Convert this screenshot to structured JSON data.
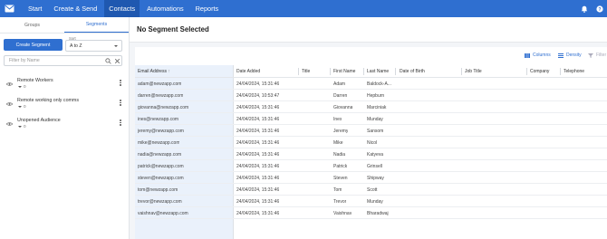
{
  "nav": {
    "items": [
      "Start",
      "Create & Send",
      "Contacts",
      "Automations",
      "Reports"
    ],
    "active_index": 2,
    "icons": [
      "bell-icon",
      "help-icon"
    ],
    "accent": "#2f6fd0"
  },
  "left": {
    "tabs": [
      "Groups",
      "Segments"
    ],
    "active_tab": 1,
    "create_label": "Create Segment",
    "sort_label": "Sort",
    "sort_value": "A to Z",
    "filter_placeholder": "Filter by Name",
    "segments": [
      {
        "name": "Remote Workers",
        "count": "0"
      },
      {
        "name": "Remote working only comms",
        "count": "0"
      },
      {
        "name": "Unopened Audience",
        "count": "0"
      }
    ]
  },
  "main": {
    "title": "No Segment Selected",
    "toolbar": {
      "columns": "Columns",
      "density": "Density",
      "filter": "Filter"
    },
    "columns": [
      "Email Address",
      "Date Added",
      "Title",
      "First Name",
      "Last Name",
      "Date of Birth",
      "Job Title",
      "Company",
      "Telephone"
    ],
    "rows": [
      [
        "adam@newzapp.com",
        "24/04/2024, 15:31:46",
        "",
        "Adam",
        "Baldock-A..."
      ],
      [
        "darren@newzapp.com",
        "24/04/2024, 10:53:47",
        "",
        "Darren",
        "Hepburn"
      ],
      [
        "giovanna@newzapp.com",
        "24/04/2024, 15:31:46",
        "",
        "Giovanna",
        "Marciniak"
      ],
      [
        "ines@newzapp.com",
        "24/04/2024, 15:31:46",
        "",
        "Ines",
        "Munday"
      ],
      [
        "jeremy@newzapp.com",
        "24/04/2024, 15:31:46",
        "",
        "Jeremy",
        "Sansom"
      ],
      [
        "mike@newzapp.com",
        "24/04/2024, 15:31:46",
        "",
        "Mike",
        "Nicol"
      ],
      [
        "nadia@newzapp.com",
        "24/04/2024, 15:31:46",
        "",
        "Nadia",
        "Katyeva"
      ],
      [
        "patrick@newzapp.com",
        "24/04/2024, 15:31:46",
        "",
        "Patrick",
        "Grinsell"
      ],
      [
        "steven@newzapp.com",
        "24/04/2024, 15:31:46",
        "",
        "Steven",
        "Shipway"
      ],
      [
        "tom@newzapp.com",
        "24/04/2024, 15:31:46",
        "",
        "Tom",
        "Scott"
      ],
      [
        "trevor@newzapp.com",
        "24/04/2024, 15:31:46",
        "",
        "Trevor",
        "Munday"
      ],
      [
        "vaishnav@newzapp.com",
        "24/04/2024, 15:31:46",
        "",
        "Vaishnav",
        "Bharadwaj"
      ]
    ]
  }
}
